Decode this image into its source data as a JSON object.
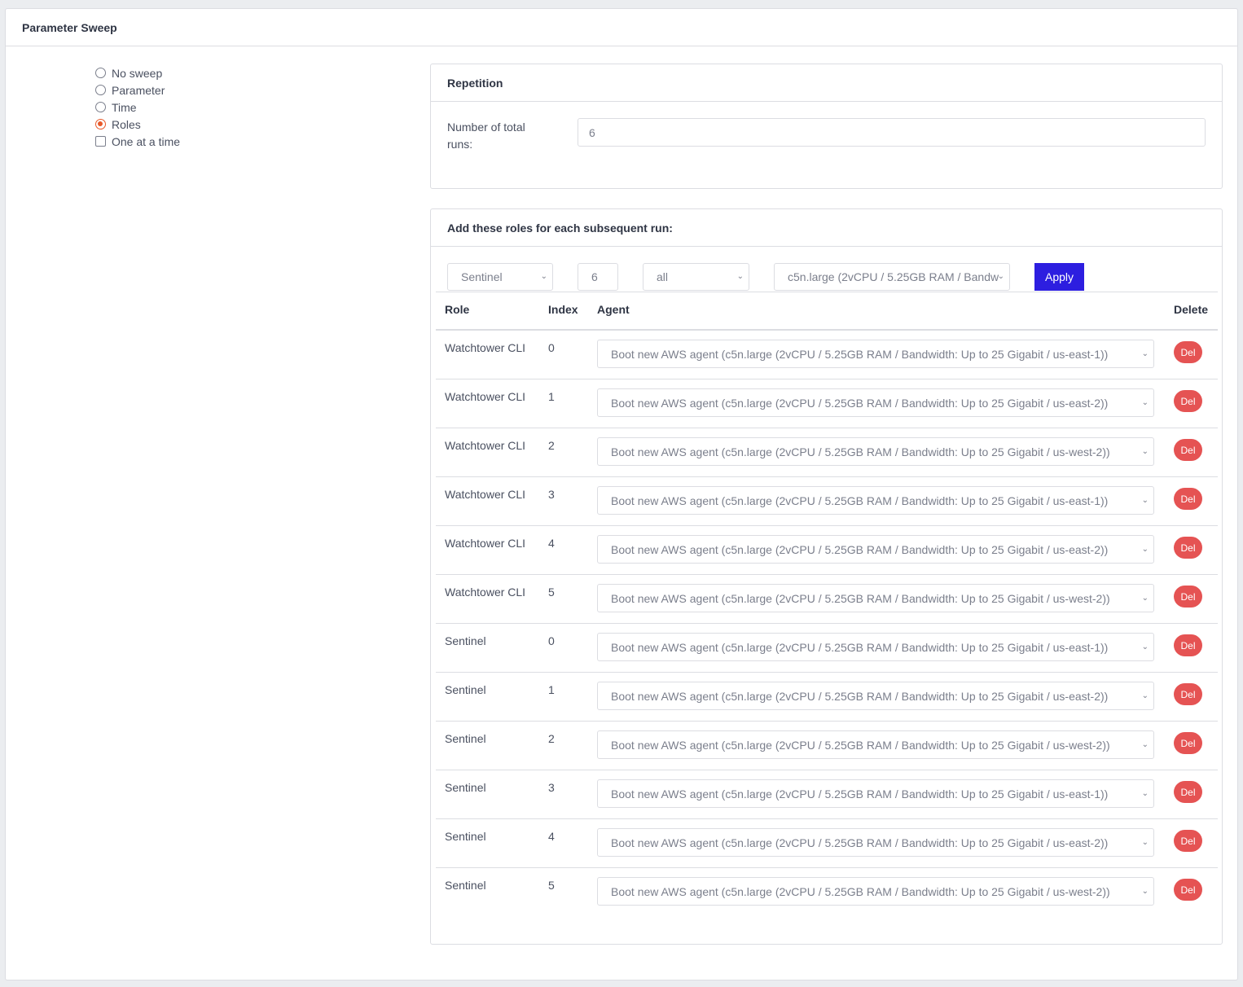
{
  "outer": {
    "title": "Parameter Sweep"
  },
  "sweep_options": [
    {
      "type": "radio",
      "label": "No sweep",
      "checked": false
    },
    {
      "type": "radio",
      "label": "Parameter",
      "checked": false
    },
    {
      "type": "radio",
      "label": "Time",
      "checked": false
    },
    {
      "type": "radio",
      "label": "Roles",
      "checked": true
    },
    {
      "type": "checkbox",
      "label": "One at a time",
      "checked": false
    }
  ],
  "repetition": {
    "title": "Repetition",
    "label": "Number of total runs:",
    "value": "6"
  },
  "roles": {
    "title": "Add these roles for each subsequent run:",
    "controls": {
      "role_select": "Sentinel",
      "count": "6",
      "index_select": "all",
      "agent_select": "c5n.large (2vCPU / 5.25GB RAM / Bandw",
      "apply_label": "Apply"
    },
    "columns": {
      "role": "Role",
      "index": "Index",
      "agent": "Agent",
      "delete": "Delete"
    },
    "rows": [
      {
        "role": "Watchtower CLI",
        "index": "0",
        "agent": "Boot new AWS agent (c5n.large (2vCPU / 5.25GB RAM / Bandwidth: Up to 25 Gigabit / us-east-1))",
        "delete": "Del"
      },
      {
        "role": "Watchtower CLI",
        "index": "1",
        "agent": "Boot new AWS agent (c5n.large (2vCPU / 5.25GB RAM / Bandwidth: Up to 25 Gigabit / us-east-2))",
        "delete": "Del"
      },
      {
        "role": "Watchtower CLI",
        "index": "2",
        "agent": "Boot new AWS agent (c5n.large (2vCPU / 5.25GB RAM / Bandwidth: Up to 25 Gigabit / us-west-2))",
        "delete": "Del"
      },
      {
        "role": "Watchtower CLI",
        "index": "3",
        "agent": "Boot new AWS agent (c5n.large (2vCPU / 5.25GB RAM / Bandwidth: Up to 25 Gigabit / us-east-1))",
        "delete": "Del"
      },
      {
        "role": "Watchtower CLI",
        "index": "4",
        "agent": "Boot new AWS agent (c5n.large (2vCPU / 5.25GB RAM / Bandwidth: Up to 25 Gigabit / us-east-2))",
        "delete": "Del"
      },
      {
        "role": "Watchtower CLI",
        "index": "5",
        "agent": "Boot new AWS agent (c5n.large (2vCPU / 5.25GB RAM / Bandwidth: Up to 25 Gigabit / us-west-2))",
        "delete": "Del"
      },
      {
        "role": "Sentinel",
        "index": "0",
        "agent": "Boot new AWS agent (c5n.large (2vCPU / 5.25GB RAM / Bandwidth: Up to 25 Gigabit / us-east-1))",
        "delete": "Del"
      },
      {
        "role": "Sentinel",
        "index": "1",
        "agent": "Boot new AWS agent (c5n.large (2vCPU / 5.25GB RAM / Bandwidth: Up to 25 Gigabit / us-east-2))",
        "delete": "Del"
      },
      {
        "role": "Sentinel",
        "index": "2",
        "agent": "Boot new AWS agent (c5n.large (2vCPU / 5.25GB RAM / Bandwidth: Up to 25 Gigabit / us-west-2))",
        "delete": "Del"
      },
      {
        "role": "Sentinel",
        "index": "3",
        "agent": "Boot new AWS agent (c5n.large (2vCPU / 5.25GB RAM / Bandwidth: Up to 25 Gigabit / us-east-1))",
        "delete": "Del"
      },
      {
        "role": "Sentinel",
        "index": "4",
        "agent": "Boot new AWS agent (c5n.large (2vCPU / 5.25GB RAM / Bandwidth: Up to 25 Gigabit / us-east-2))",
        "delete": "Del"
      },
      {
        "role": "Sentinel",
        "index": "5",
        "agent": "Boot new AWS agent (c5n.large (2vCPU / 5.25GB RAM / Bandwidth: Up to 25 Gigabit / us-west-2))",
        "delete": "Del"
      }
    ]
  },
  "colors": {
    "accent_radio": "#e8592a",
    "apply_button": "#2d1ee0",
    "delete_button": "#e55353",
    "page_bg": "#ebedf0"
  }
}
